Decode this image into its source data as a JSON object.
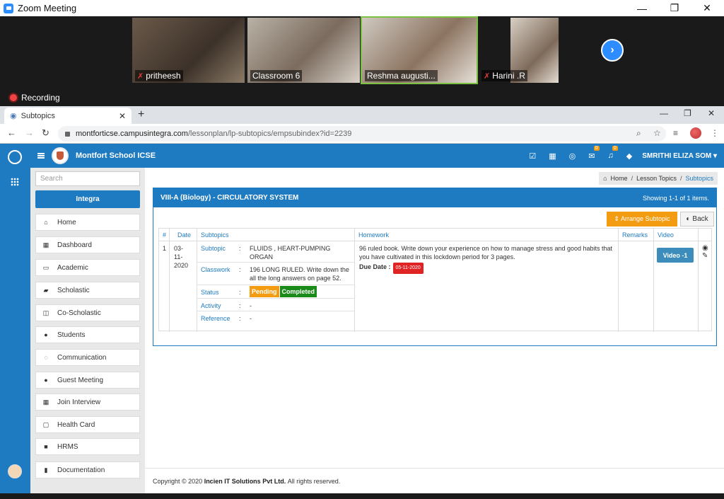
{
  "zoom": {
    "title": "Zoom Meeting",
    "recording": "Recording",
    "participants": [
      {
        "name": "pritheesh",
        "muted": true
      },
      {
        "name": "Classroom 6",
        "muted": false
      },
      {
        "name": "Reshma augusti...",
        "muted": false
      },
      {
        "name": "Harini .R",
        "muted": true
      }
    ],
    "controls": {
      "minimize": "—",
      "restore": "❐",
      "close": "✕"
    }
  },
  "browser": {
    "tab_title": "Subtopics",
    "new_tab": "+",
    "url_host": "montforticse.campusintegra.com",
    "url_path": "/lessonplan/lp-subtopics/empsubindex?id=2239"
  },
  "app": {
    "school_name": "Montfort School ICSE",
    "user_name": "SMRITHI ELIZA SOM",
    "notification_counts": {
      "messages": "0",
      "alerts": "0"
    },
    "search_placeholder": "Search",
    "integra_label": "Integra",
    "menu": [
      {
        "label": "Home",
        "icon": "home-icon",
        "glyph": "⌂"
      },
      {
        "label": "Dashboard",
        "icon": "dashboard-icon",
        "glyph": "▦"
      },
      {
        "label": "Academic",
        "icon": "calendar-icon",
        "glyph": "▭"
      },
      {
        "label": "Scholastic",
        "icon": "book-icon",
        "glyph": "▰"
      },
      {
        "label": "Co-Scholastic",
        "icon": "co-scholastic-icon",
        "glyph": "◫"
      },
      {
        "label": "Students",
        "icon": "users-icon",
        "glyph": "●"
      },
      {
        "label": "Communication",
        "icon": "chat-icon",
        "glyph": "◌"
      },
      {
        "label": "Guest Meeting",
        "icon": "group-icon",
        "glyph": "●"
      },
      {
        "label": "Join Interview",
        "icon": "calendar-icon",
        "glyph": "▦"
      },
      {
        "label": "Health Card",
        "icon": "card-icon",
        "glyph": "▢"
      },
      {
        "label": "HRMS",
        "icon": "user-icon",
        "glyph": "■"
      },
      {
        "label": "Documentation",
        "icon": "document-icon",
        "glyph": "▮"
      }
    ],
    "breadcrumb": {
      "home": "Home",
      "lesson_topics": "Lesson Topics",
      "current": "Subtopics",
      "separator": "/"
    },
    "panel": {
      "title": "VIII-A (Biology) - CIRCULATORY SYSTEM",
      "showing": "Showing 1-1 of 1 items.",
      "arrange_label": "⇕ Arrange Subtopic",
      "back_label": "Back"
    },
    "table": {
      "headers": {
        "num": "#",
        "date": "Date",
        "subtopics": "Subtopics",
        "homework": "Homework",
        "remarks": "Remarks",
        "video": "Video"
      },
      "row": {
        "num": "1",
        "date_lines": [
          "03-",
          "11-",
          "2020"
        ],
        "subtopic_label": "Subtopic",
        "subtopic_value": "FLUIDS , HEART-PUMPING ORGAN",
        "classwork_label": "Classwork",
        "classwork_value": "196 LONG RULED. Write down the all the long answers on page 52.",
        "status_label": "Status",
        "status_pending": "Pending",
        "status_completed": "Completed",
        "activity_label": "Activity",
        "activity_value": "-",
        "reference_label": "Reference",
        "reference_value": "-",
        "colon": ":",
        "homework_text": "96 ruled book. Write down your experience on how to manage stress and good habits that you have cultivated in this lockdown period for 3 pages.",
        "due_label": "Due Date :",
        "due_value": "05-11-2020",
        "remarks": "",
        "video_label": "Video -1"
      }
    },
    "footer": {
      "prefix": "Copyright © 2020",
      "company": "Incien IT Solutions Pvt Ltd.",
      "suffix": "All rights reserved."
    }
  }
}
